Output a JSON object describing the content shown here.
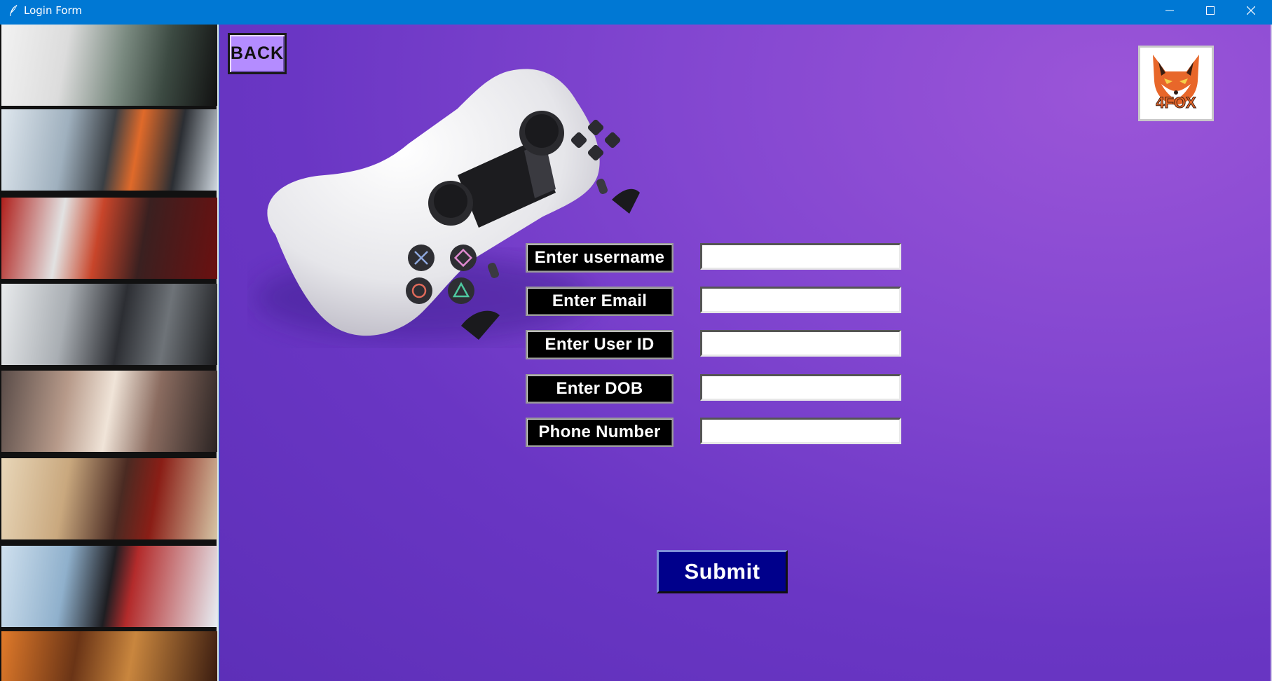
{
  "window": {
    "title": "Login Form"
  },
  "header": {
    "back_label": "BACK",
    "logo_text": "4FOX"
  },
  "form": {
    "fields": [
      {
        "label": "Enter username",
        "value": ""
      },
      {
        "label": "Enter Email",
        "value": ""
      },
      {
        "label": "Enter User ID",
        "value": ""
      },
      {
        "label": "Enter DOB",
        "value": ""
      },
      {
        "label": "Phone Number",
        "value": ""
      }
    ],
    "submit_label": "Submit"
  },
  "colors": {
    "titlebar": "#0078d4",
    "background_purple": "#7a3fcf",
    "back_button": "#b48cff",
    "submit_button": "#00008b",
    "label_bg": "#000000"
  },
  "icons": {
    "app": "feather-icon",
    "minimize": "minimize-icon",
    "maximize": "maximize-icon",
    "close": "close-icon"
  }
}
